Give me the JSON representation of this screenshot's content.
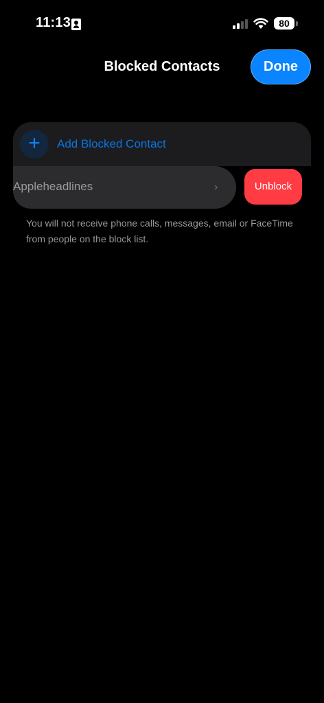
{
  "status_bar": {
    "time": "11:13",
    "battery": "80",
    "icons": [
      "id-card-icon",
      "cellular-signal-icon",
      "wifi-icon",
      "battery-icon"
    ]
  },
  "nav": {
    "title": "Blocked Contacts",
    "done_label": "Done"
  },
  "list": {
    "add_label": "Add Blocked Contact",
    "add_icon": "+",
    "blocked_contacts": [
      {
        "name": "Appleheadlines",
        "action_label": "Unblock"
      }
    ]
  },
  "footer_note": "You will not receive phone calls, messages, email or FaceTime from people on the block list.",
  "colors": {
    "accent": "#0a84ff",
    "destructive": "#ff3b43",
    "background": "#000000",
    "cell": "#1c1c1e"
  }
}
